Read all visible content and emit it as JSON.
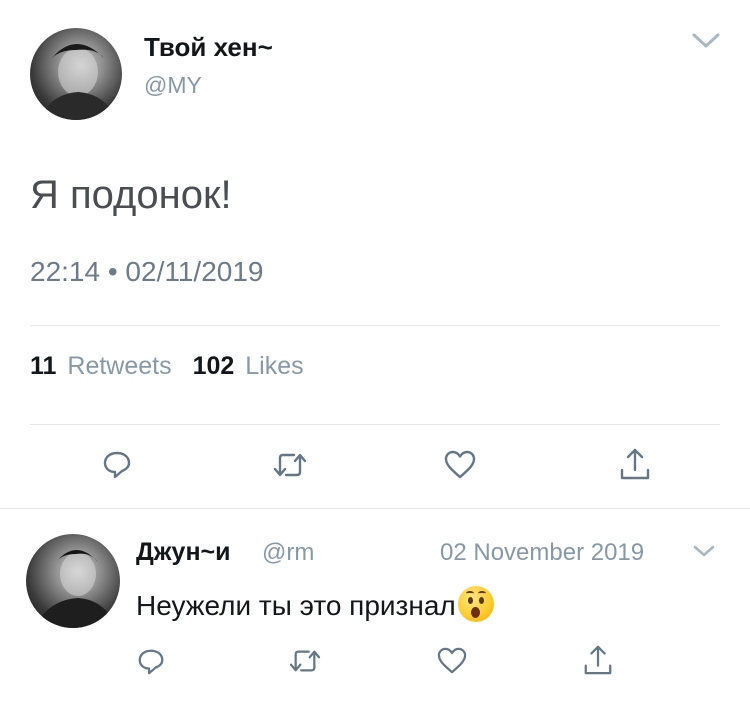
{
  "tweet": {
    "author_name": "Твой хен~",
    "author_handle": "@MY",
    "text": "Я подонок!",
    "timestamp": "22:14 • 02/11/2019",
    "retweets_count": "11",
    "retweets_label": "Retweets",
    "likes_count": "102",
    "likes_label": "Likes"
  },
  "reply": {
    "author_name": "Джун~и",
    "author_handle": "@rm",
    "date": "02 November 2019",
    "text": "Неужели ты это признал"
  },
  "icons": {
    "menu": "chevron-down-icon",
    "reply": "reply-icon",
    "retweet": "retweet-icon",
    "like": "heart-icon",
    "share": "share-icon",
    "emoji": "astonished-face-emoji"
  },
  "colors": {
    "text": "#14171a",
    "muted": "#8899a6",
    "divider": "#e1e8ed"
  }
}
